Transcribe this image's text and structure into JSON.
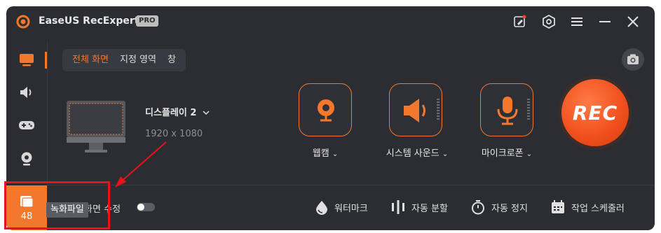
{
  "app": {
    "title": "EaseUS RecExperts",
    "badge": "PRO"
  },
  "titlebar_icons": [
    "feedback-icon",
    "settings-icon",
    "menu-icon",
    "minimize-icon",
    "close-icon"
  ],
  "sidebar": {
    "items": [
      {
        "name": "screen",
        "icon": "monitor-icon",
        "active": true
      },
      {
        "name": "audio",
        "icon": "speaker-icon"
      },
      {
        "name": "game",
        "icon": "gamepad-icon"
      },
      {
        "name": "webcam",
        "icon": "webcam-icon"
      }
    ],
    "files": {
      "count": "48",
      "tooltip": "녹화파일"
    }
  },
  "tabs": [
    {
      "label": "전체 화면",
      "active": true
    },
    {
      "label": "지정 영역",
      "active": false
    },
    {
      "label": "창",
      "active": false
    }
  ],
  "display": {
    "name": "디스플레이 2",
    "resolution": "1920 x 1080"
  },
  "sources": [
    {
      "label": "웹캠",
      "icon": "webcam-icon"
    },
    {
      "label": "시스템 사운드",
      "icon": "speaker-icon"
    },
    {
      "label": "마이크로폰",
      "icon": "microphone-icon"
    }
  ],
  "rec_label": "REC",
  "auto_edit": {
    "label": "자동 화면 수정",
    "enabled": false
  },
  "features": [
    {
      "label": "워터마크",
      "icon": "watermark-icon"
    },
    {
      "label": "자동 분할",
      "icon": "split-icon"
    },
    {
      "label": "자동 정지",
      "icon": "timer-icon"
    },
    {
      "label": "작업 스케줄러",
      "icon": "calendar-icon"
    }
  ],
  "colors": {
    "accent": "#f4782b",
    "background": "#2b2d33",
    "highlight": "#e8131a",
    "rec": "#f04e1c"
  }
}
